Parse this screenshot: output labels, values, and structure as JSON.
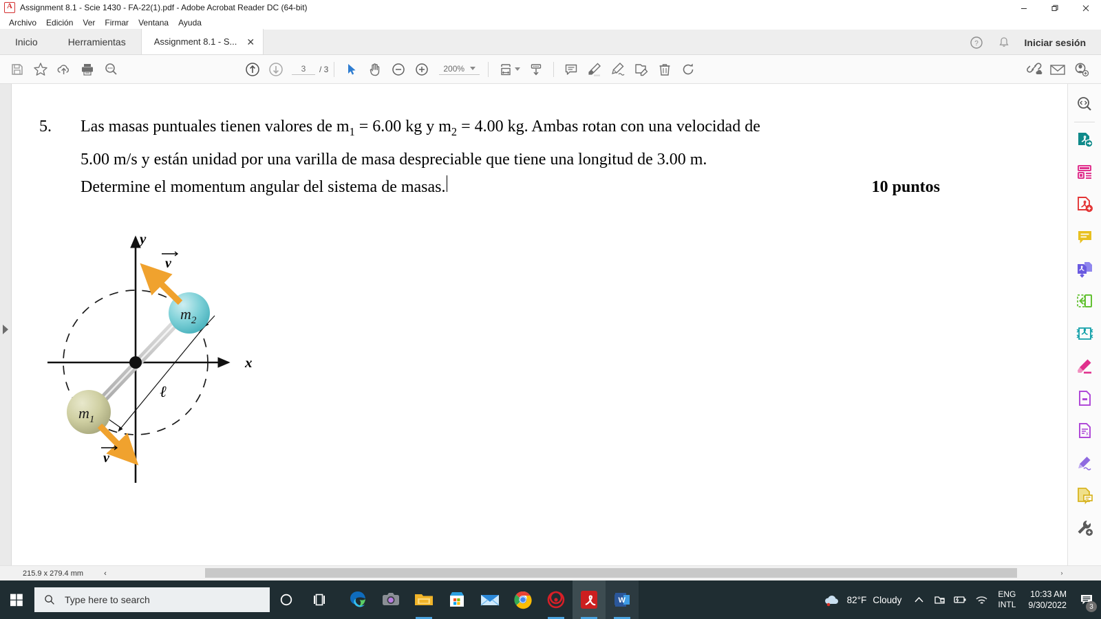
{
  "window": {
    "title": "Assignment 8.1 - Scie 1430 - FA-22(1).pdf - Adobe Acrobat Reader DC (64-bit)",
    "app_icon": "acrobat-icon",
    "minimize": "—",
    "maximize": "❐",
    "close": "✕"
  },
  "menu": {
    "items": [
      {
        "label": "Archivo"
      },
      {
        "label": "Edición"
      },
      {
        "label": "Ver"
      },
      {
        "label": "Firmar"
      },
      {
        "label": "Ventana"
      },
      {
        "label": "Ayuda"
      }
    ]
  },
  "tabs": {
    "home_label": "Inicio",
    "tools_label": "Herramientas",
    "document_label": "Assignment 8.1 - S...",
    "close_glyph": "✕",
    "help_icon": "help-circle-icon",
    "bell_icon": "bell-icon",
    "signin_label": "Iniciar sesión"
  },
  "toolbar": {
    "save_icon": "save-icon",
    "star_icon": "star-icon",
    "upload_cloud_icon": "upload-cloud-icon",
    "print_icon": "print-icon",
    "search_icon": "search-icon",
    "page_up_icon": "page-up-arrow-icon",
    "page_down_icon": "page-down-arrow-icon",
    "current_page": "3",
    "page_separator": "/ 3",
    "total_pages": "3",
    "select_icon": "select-cursor-icon",
    "hand_icon": "hand-tool-icon",
    "zoom_out_icon": "zoom-out-icon",
    "zoom_in_icon": "zoom-in-icon",
    "zoom_value": "200%",
    "zoom_caret": "chevron-down-icon",
    "fit_page_icon": "fit-page-icon",
    "fit_caret": "chevron-down-icon",
    "scroll_mode_icon": "scroll-mode-icon",
    "comment_icon": "comment-icon",
    "highlight_icon": "highlight-icon",
    "draw_icon": "draw-freehand-icon",
    "sign_icon": "fill-and-sign-icon",
    "delete_icon": "trash-icon",
    "rotate_icon": "rotate-icon",
    "share_link_icon": "share-link-icon",
    "email_icon": "email-icon",
    "add_user_icon": "add-user-icon"
  },
  "document": {
    "question_number": "5.",
    "line1": "Las masas puntuales tienen valores de m",
    "sub1": "1",
    "line1b": " = 6.00 kg y m",
    "sub2": "2",
    "line1c": " = 4.00 kg. Ambas rotan con una velocidad de",
    "line2": "5.00 m/s y están unidad por una varilla de masa despreciable que tiene una longitud de 3.00 m.",
    "line3": "Determine el momentum angular del sistema de masas.",
    "points": "10 puntos",
    "figure": {
      "axis_x_label": "x",
      "axis_y_label": "y",
      "mass1_label": "m",
      "mass1_sub": "1",
      "mass2_label": "m",
      "mass2_sub": "2",
      "length_label": "ℓ",
      "velocity_label": "v",
      "mass1_color": "#c8c89a",
      "mass2_color": "#7fd1d8",
      "velocity_arrow_color": "#f0a22e",
      "rod_color": "#c9c9c9"
    }
  },
  "right_rail": {
    "items": [
      {
        "name": "search-document-icon",
        "color": "#5a5a5a"
      },
      {
        "name": "export-pdf-icon",
        "color": "#0f8a8a"
      },
      {
        "name": "organize-pages-icon",
        "color": "#e0308d"
      },
      {
        "name": "create-pdf-icon",
        "color": "#e33434"
      },
      {
        "name": "comment-icon",
        "color": "#e8c020"
      },
      {
        "name": "combine-files-icon",
        "color": "#6a5ae0"
      },
      {
        "name": "compress-pdf-icon",
        "color": "#63c132"
      },
      {
        "name": "edit-pdf-icon",
        "color": "#0f9fa8"
      },
      {
        "name": "highlight-text-icon",
        "color": "#e0308d"
      },
      {
        "name": "protect-pdf-icon",
        "color": "#b04ad8"
      },
      {
        "name": "fill-sign-form-icon",
        "color": "#b04ad8"
      },
      {
        "name": "request-signature-icon",
        "color": "#8f6ae0"
      },
      {
        "name": "add-comment-note-icon",
        "color": "#d8b420"
      },
      {
        "name": "more-tools-icon",
        "color": "#5a5a5a"
      }
    ]
  },
  "status": {
    "page_size": "215.9 x 279.4 mm",
    "chevron": "‹",
    "scroll_right_glyph": "›"
  },
  "scroll": {
    "up_glyph": "⌃",
    "down_glyph": "⌄",
    "collapse_right_icon": "collapse-panel-icon",
    "expand_left_icon": "expand-panel-icon"
  },
  "taskbar": {
    "start_icon": "windows-start-icon",
    "search_icon": "search-icon",
    "search_placeholder": "Type here to search",
    "cortana_icon": "cortana-circle-icon",
    "taskview_icon": "task-view-icon",
    "apps": [
      {
        "name": "microsoft-edge-icon"
      },
      {
        "name": "camera-icon"
      },
      {
        "name": "file-explorer-icon"
      },
      {
        "name": "microsoft-store-icon"
      },
      {
        "name": "mail-icon"
      },
      {
        "name": "google-chrome-icon"
      },
      {
        "name": "spiral-app-icon"
      },
      {
        "name": "adobe-acrobat-icon"
      },
      {
        "name": "microsoft-word-icon"
      }
    ],
    "weather_icon": "cloud-icon",
    "weather_temp": "82°F",
    "weather_desc": "Cloudy",
    "show_hidden_glyph": "⌃",
    "onedrive_icon": "onedrive-icon",
    "battery_icon": "battery-icon",
    "wifi_icon": "wifi-icon",
    "lang_line1": "ENG",
    "lang_line2": "INTL",
    "time": "10:33 AM",
    "date": "9/30/2022",
    "notification_icon": "notification-icon",
    "notification_count": "3"
  }
}
